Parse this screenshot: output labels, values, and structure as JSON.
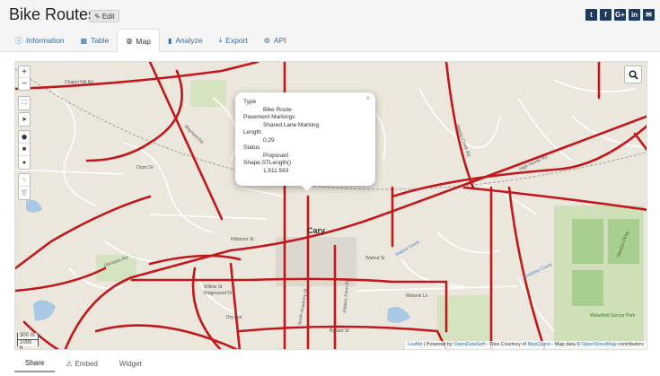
{
  "header": {
    "title": "Bike Routes",
    "edit_label": "Edit",
    "social": [
      {
        "icon": "twitter-icon",
        "glyph": "t"
      },
      {
        "icon": "facebook-icon",
        "glyph": "f"
      },
      {
        "icon": "google-plus-icon",
        "glyph": "G+"
      },
      {
        "icon": "linkedin-icon",
        "glyph": "in"
      },
      {
        "icon": "email-icon",
        "glyph": "✉"
      }
    ]
  },
  "tabs": [
    {
      "label": "Information",
      "icon": "info-icon",
      "glyph": "ⓘ"
    },
    {
      "label": "Table",
      "icon": "table-icon",
      "glyph": "▦"
    },
    {
      "label": "Map",
      "icon": "globe-icon",
      "glyph": "◍"
    },
    {
      "label": "Analyze",
      "icon": "chart-icon",
      "glyph": "▮"
    },
    {
      "label": "Export",
      "icon": "download-icon",
      "glyph": "⤓"
    },
    {
      "label": "API",
      "icon": "gear-icon",
      "glyph": "⚙"
    }
  ],
  "active_tab": "Map",
  "map": {
    "city_label": "Cary",
    "popup": {
      "close": "×",
      "fields": [
        {
          "label": "Type",
          "value": "Bike Route"
        },
        {
          "label": "Pavement Markings",
          "value": "Shared Lane Marking"
        },
        {
          "label": "Length",
          "value": "0.29"
        },
        {
          "label": "Status",
          "value": "Proposed"
        },
        {
          "label": "Shape.STLength()",
          "value": "1,511.563"
        }
      ]
    },
    "scale": {
      "metric": "300 m",
      "imperial": "1000 ft"
    },
    "attribution": {
      "leaflet": "Leaflet",
      "powered": " | Powered by ",
      "ods": "OpenDataSoft",
      "tiles": " - Tiles Courtesy of ",
      "mq": "MapQuest",
      "mapdata": " - Map data © ",
      "osm": "OpenStreetMap",
      "contrib": " contributors"
    },
    "street_labels": [
      "Chapel Hill Rd",
      "Maynard Rd",
      "Reedy Creek Rd",
      "Old Apex Rd",
      "South Academy St",
      "Walnut Creek",
      "Kildaire Farm Rd",
      "High House Rd",
      "Walnut St",
      "Dry Ave",
      "Bynum St",
      "Melanie Ln",
      "Ridgewood Dr",
      "Willow St",
      "Hillsboro St",
      "Crabtree Creek",
      "Ooze Dr",
      "Wakefield Soccer Park",
      "Weston Pkwy"
    ],
    "route_color": "#c2181c"
  },
  "bottom_tabs": [
    {
      "label": "Share"
    },
    {
      "label": "Embed",
      "icon": "warning-icon",
      "glyph": "⚠"
    },
    {
      "label": "Widget"
    }
  ]
}
